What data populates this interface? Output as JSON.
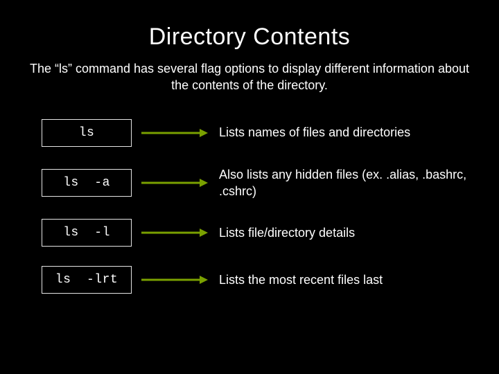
{
  "title": "Directory Contents",
  "subtitle": "The “ls” command has several flag options to display different information about the contents of the directory.",
  "arrow_color": "#7aa000",
  "commands": [
    {
      "cmd": "ls",
      "desc": "Lists names of files and directories"
    },
    {
      "cmd": "ls  -a",
      "desc": "Also lists any hidden files (ex. .alias, .bashrc, .cshrc)"
    },
    {
      "cmd": "ls  -l",
      "desc": "Lists file/directory details"
    },
    {
      "cmd": "ls  -lrt",
      "desc": "Lists the most recent files last"
    }
  ]
}
